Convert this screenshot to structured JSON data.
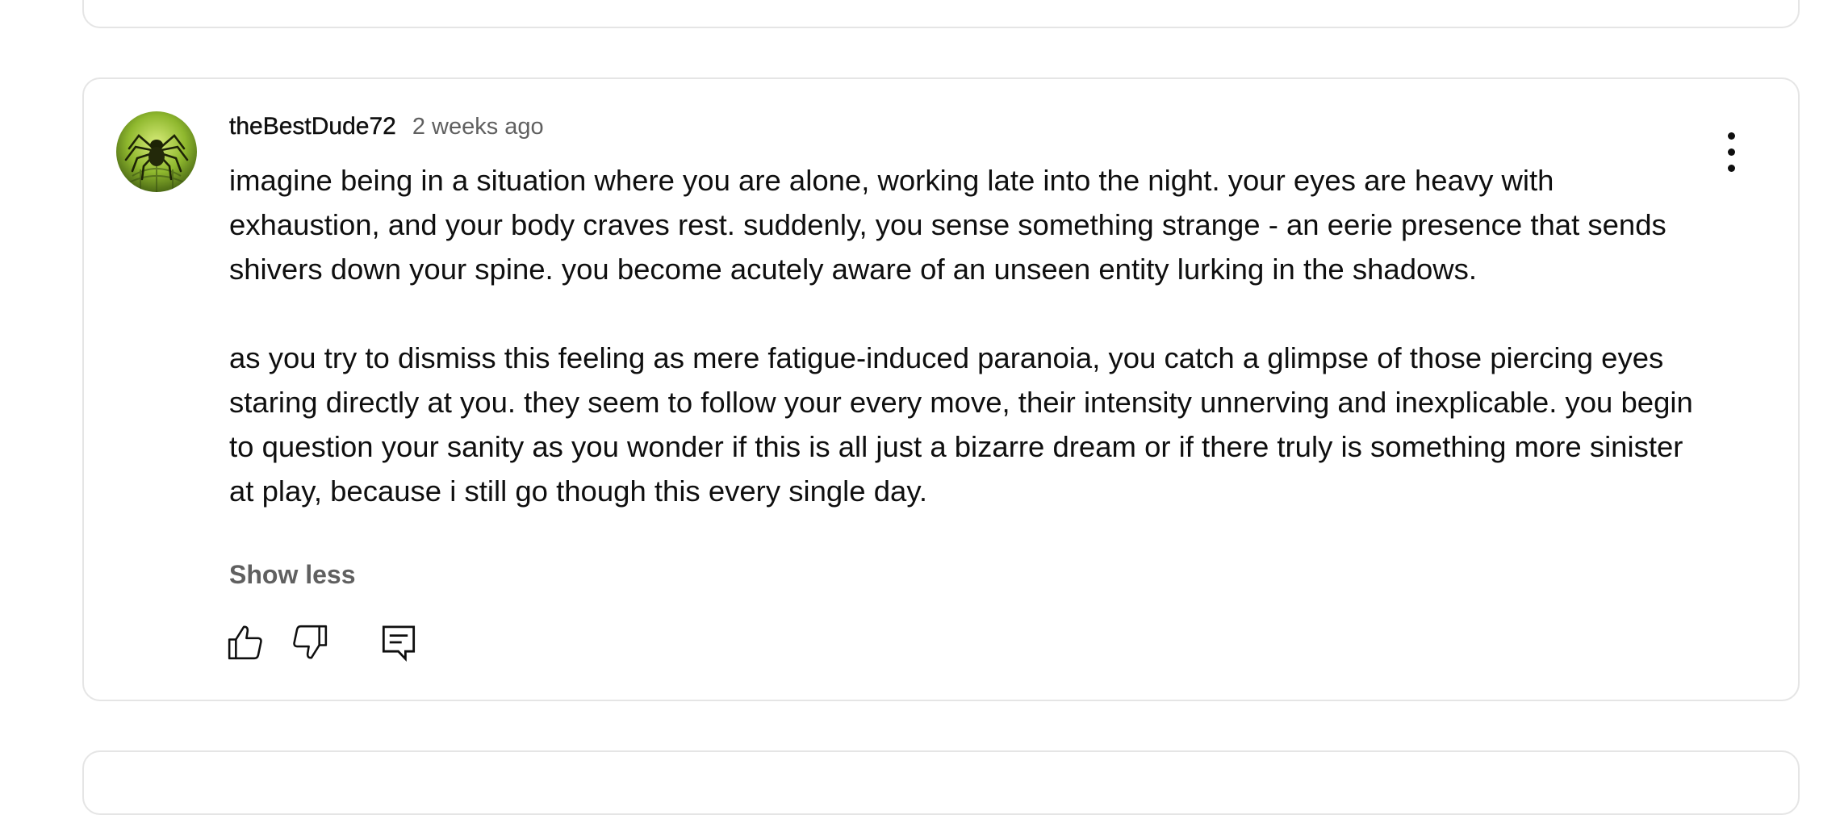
{
  "comment": {
    "author": "theBestDude72",
    "time": "2 weeks ago",
    "paragraphs": [
      "imagine being in a situation where you are alone, working late into the night. your eyes are heavy with exhaustion, and your body craves rest. suddenly, you sense something strange - an eerie presence that sends shivers down your spine. you become acutely aware of an unseen entity lurking in the shadows.",
      "as you try to dismiss this feeling as mere fatigue-induced paranoia, you catch a glimpse of those piercing eyes staring directly at you. they seem to follow your every move, their intensity unnerving and inexplicable. you begin to question your sanity as you wonder if this is all just a bizarre dream or if there truly is something more sinister at play, because i still go though this every single day."
    ],
    "show_less_label": "Show less"
  },
  "icons": {
    "avatar": "spider-avatar",
    "menu": "more-vert-icon",
    "like": "thumb-up-icon",
    "dislike": "thumb-down-icon",
    "reply": "reply-comment-icon"
  },
  "colors": {
    "text_primary": "#0f0f0f",
    "text_secondary": "#606060",
    "card_border": "#e5e5e5",
    "avatar_green": "#8fb82e"
  }
}
